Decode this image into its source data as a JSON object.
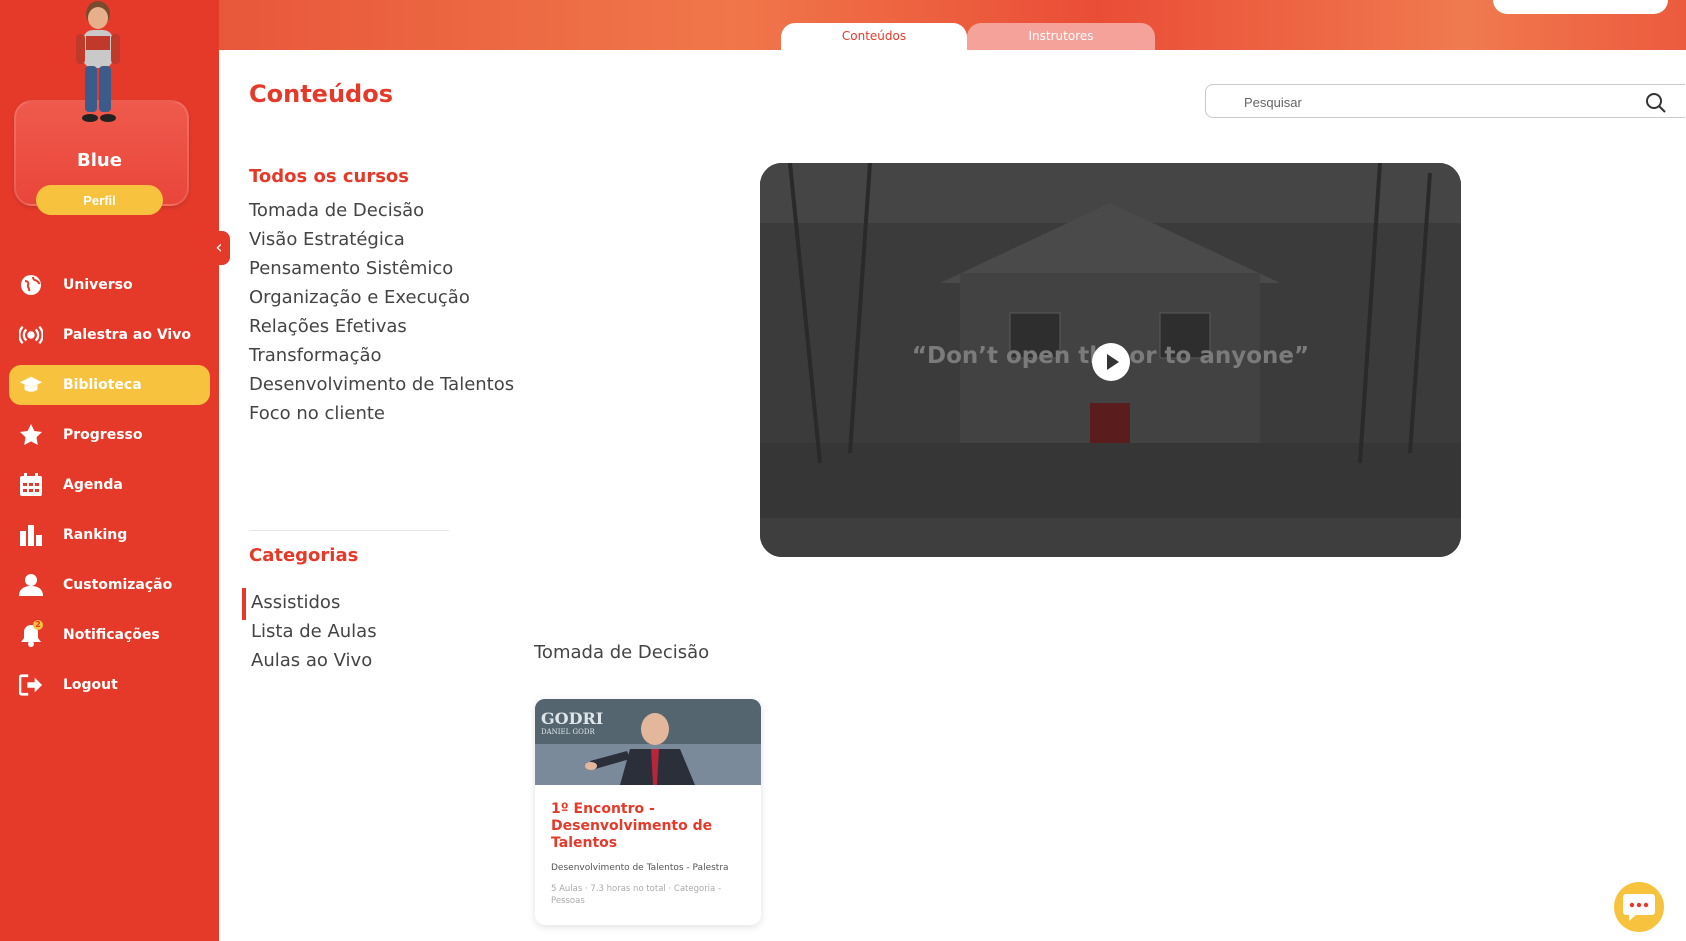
{
  "sidebar": {
    "username": "Blue",
    "profile_button": "Perfil",
    "items": [
      {
        "label": "Universo",
        "icon": "globe-icon",
        "active": false
      },
      {
        "label": "Palestra ao Vivo",
        "icon": "broadcast-icon",
        "active": false
      },
      {
        "label": "Biblioteca",
        "icon": "graduation-cap-icon",
        "active": true
      },
      {
        "label": "Progresso",
        "icon": "star-icon",
        "active": false
      },
      {
        "label": "Agenda",
        "icon": "calendar-icon",
        "active": false
      },
      {
        "label": "Ranking",
        "icon": "bar-chart-icon",
        "active": false
      },
      {
        "label": "Customização",
        "icon": "user-icon",
        "active": false
      },
      {
        "label": "Notificações",
        "icon": "bell-icon",
        "active": false,
        "badge": "2"
      },
      {
        "label": "Logout",
        "icon": "logout-icon",
        "active": false
      }
    ]
  },
  "tabs": [
    {
      "label": "Conteúdos",
      "active": true
    },
    {
      "label": "Instrutores",
      "active": false
    }
  ],
  "main": {
    "title": "Conteúdos",
    "search_placeholder": "Pesquisar",
    "courses_title": "Todos os cursos",
    "courses": [
      "Tomada de Decisão",
      "Visão Estratégica",
      "Pensamento Sistêmico",
      "Organização e Execução",
      "Relações Efetivas",
      "Transformação",
      "Desenvolvimento de Talentos",
      "Foco no cliente"
    ],
    "categories_title": "Categorias",
    "categories": [
      "Assistidos",
      "Lista de Aulas",
      "Aulas ao Vivo"
    ],
    "video_caption": "“Don’t open th  oor to anyone”",
    "row_title": "Tomada de Decisão",
    "card": {
      "title": "1º Encontro - Desenvolvimento de Talentos",
      "description": "Desenvolvimento de Talentos - Palestra",
      "meta": "5 Aulas · 7.3 horas no total · Categoria - Pessoas"
    }
  },
  "colors": {
    "primary_red": "#e53a2a",
    "accent_yellow": "#f7c33e"
  }
}
